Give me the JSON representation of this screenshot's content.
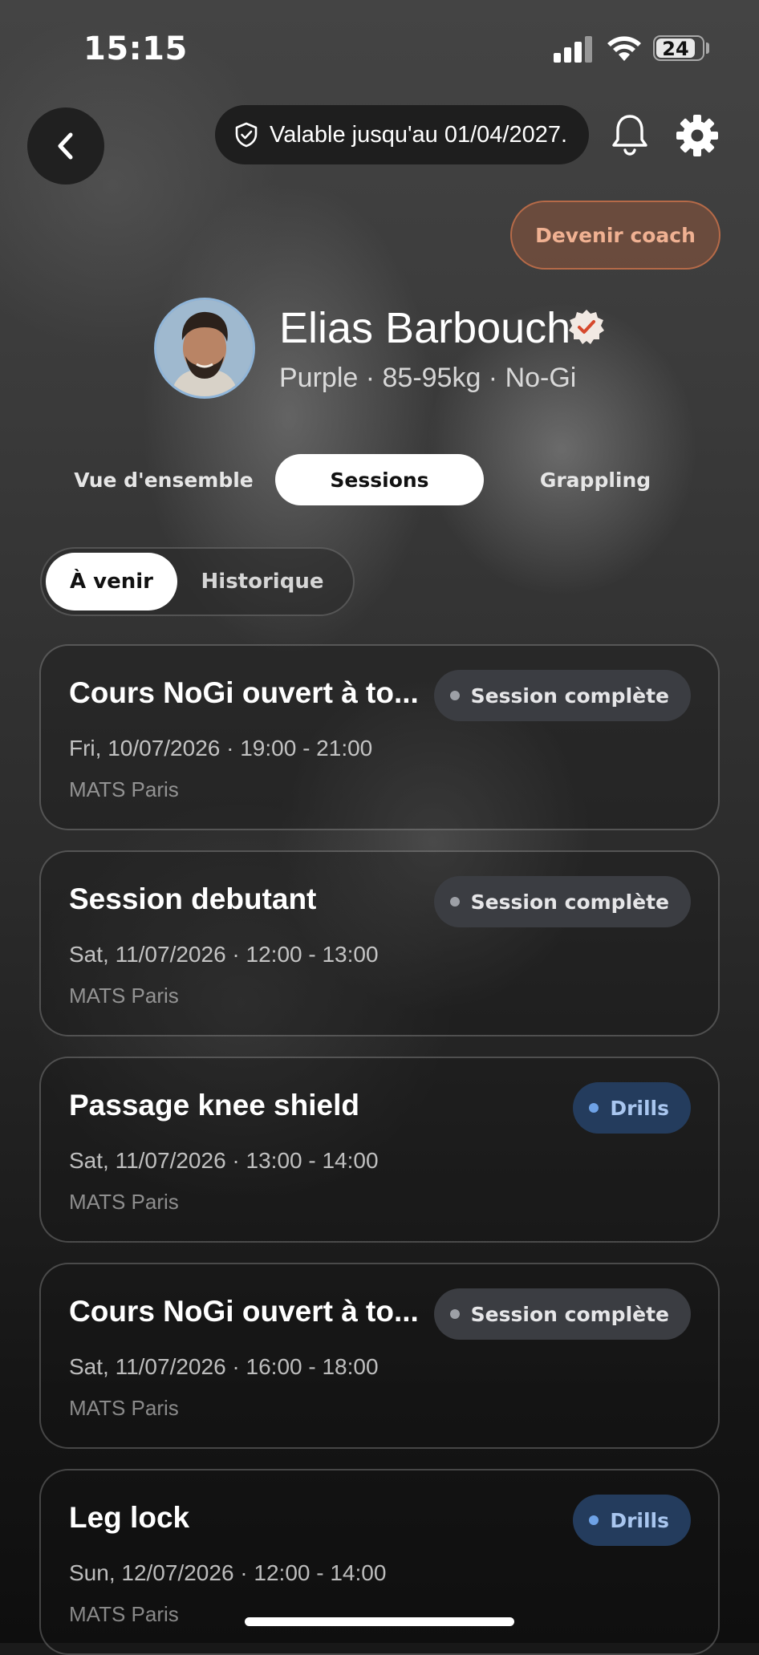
{
  "status_bar": {
    "time": "15:15",
    "battery": "24"
  },
  "header": {
    "validity_text": "Valable jusqu'au 01/04/2027.",
    "coach_button_label": "Devenir coach"
  },
  "profile": {
    "name": "Elias Barbouch",
    "subtitle": "Purple · 85-95kg · No-Gi"
  },
  "tabs": [
    {
      "label": "Vue d'ensemble",
      "active": false
    },
    {
      "label": "Sessions",
      "active": true
    },
    {
      "label": "Grappling",
      "active": false
    }
  ],
  "segment": [
    {
      "label": "À venir",
      "active": true
    },
    {
      "label": "Historique",
      "active": false
    }
  ],
  "sessions": [
    {
      "title": "Cours NoGi ouvert à to...",
      "date": "Fri, 10/07/2026 · 19:00 - 21:00",
      "location": "MATS Paris",
      "tag": "Session complète",
      "tag_type": "full"
    },
    {
      "title": "Session debutant",
      "date": "Sat, 11/07/2026 · 12:00 - 13:00",
      "location": "MATS Paris",
      "tag": "Session complète",
      "tag_type": "full"
    },
    {
      "title": "Passage knee shield",
      "date": "Sat, 11/07/2026 · 13:00 - 14:00",
      "location": "MATS Paris",
      "tag": "Drills",
      "tag_type": "drills"
    },
    {
      "title": "Cours NoGi ouvert à to...",
      "date": "Sat, 11/07/2026 · 16:00 - 18:00",
      "location": "MATS Paris",
      "tag": "Session complète",
      "tag_type": "full"
    },
    {
      "title": "Leg lock",
      "date": "Sun, 12/07/2026 · 12:00 - 14:00",
      "location": "MATS Paris",
      "tag": "Drills",
      "tag_type": "drills"
    }
  ],
  "colors": {
    "coach_accent": "#b66a48",
    "drills_pill": "#243c5d",
    "full_pill": "#3b3d42"
  }
}
